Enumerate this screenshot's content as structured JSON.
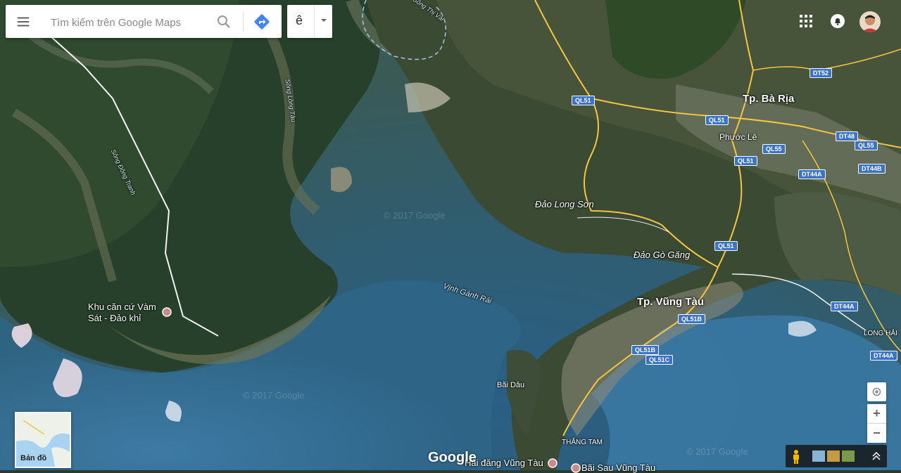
{
  "search": {
    "placeholder": "Tìm kiếm trên Google Maps"
  },
  "language": {
    "label": "ê"
  },
  "icons": {
    "menu": "hamburger-menu-icon",
    "search": "magnifier-icon",
    "directions": "directions-arrow-icon",
    "caret": "caret-down-icon",
    "apps": "grid-apps-icon",
    "notifications": "bell-icon",
    "locate": "my-location-icon",
    "pegman": "street-view-pegman-icon",
    "expand": "chevron-up-double-icon"
  },
  "colors": {
    "brand_blue": "#4285f4",
    "shield_blue": "#3b73c8"
  },
  "map": {
    "places": {
      "tp_ba_ria": "Tp. Bà Rịa",
      "phuoc_le": "Phước Lê",
      "dao_long_son": "Đảo Long Sơn",
      "dao_go_gang": "Đảo Gò Găng",
      "tp_vung_tau": "Tp. Vũng Tàu",
      "khu_can_cu": "Khu căn cứ Vàm Sát - Đảo khỉ",
      "bai_dau": "Bãi Dâu",
      "thang_tam": "THẮNG TAM",
      "hai_dang": "Hải đăng Vũng Tàu",
      "bai_sau": "Bãi Sau Vũng Tàu",
      "long_hai": "LONG HẢI"
    },
    "water": {
      "vinh_ganh_rai": "Vịnh Gành Rái",
      "song_long_tau": "Sông Lòng Tàu",
      "song_dong_tranh": "Sông Đồng Tranh",
      "song_thi_vai": "Sông Thị Vải"
    },
    "routes": {
      "ql51_a": "QL51",
      "ql51_b": "QL51",
      "ql51_c": "QL51",
      "ql51_d": "QL51",
      "dt52": "DT52",
      "dt48": "DT48",
      "ql55_a": "QL55",
      "ql55_b": "QL55",
      "dt44a_a": "DT44A",
      "dt44b": "DT44B",
      "dt44a_b": "DT44A",
      "dt44a_c": "DT44A",
      "ql51b_a": "QL51B",
      "ql51b_b": "QL51B",
      "ql51c": "QL51C"
    },
    "watermark": "© 2017 Google"
  },
  "minimap": {
    "label": "Bản đồ"
  },
  "logo": "Google",
  "controls": {
    "zoom_in": "+",
    "zoom_out": "−"
  }
}
